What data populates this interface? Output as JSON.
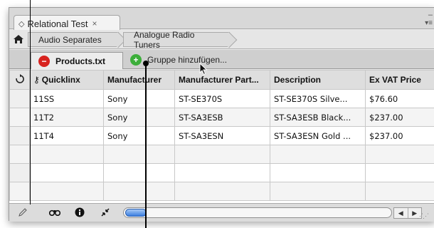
{
  "panel": {
    "tab_title": "Relational Test",
    "tab_icon": "◇",
    "tab_close": "×",
    "minimize": "–",
    "menu": "▾≡",
    "close_icon": "×"
  },
  "breadcrumbs": {
    "home_icon": "home-icon",
    "items": [
      "Audio Separates",
      "Analogue Radio Tuners"
    ]
  },
  "tabs": {
    "active_label": "Products.txt",
    "active_icon": "−",
    "add_icon": "+",
    "add_label": "Gruppe hinzufügen..."
  },
  "table": {
    "columns": [
      "Quicklinx",
      "Manufacturer",
      "Manufacturer Part...",
      "Description",
      "Ex VAT Price"
    ],
    "rows": [
      [
        "11SS",
        "Sony",
        "ST-SE370S",
        "ST-SE370S Silve...",
        "$76.60"
      ],
      [
        "11T2",
        "Sony",
        "ST-SA3ESB",
        "ST-SA3ESB Black...",
        "$237.00"
      ],
      [
        "11T4",
        "Sony",
        "ST-SA3ESN",
        "ST-SA3ESN Gold ...",
        "$237.00"
      ],
      [
        "",
        "",
        "",
        "",
        ""
      ],
      [
        "",
        "",
        "",
        "",
        ""
      ],
      [
        "",
        "",
        "",
        "",
        ""
      ]
    ]
  },
  "bottom_bar": {
    "icons": [
      "pencil-icon",
      "binoculars-icon",
      "info-icon",
      "collapse-icon"
    ],
    "scroll_left": "◀",
    "scroll_right": "▶"
  },
  "colors": {
    "remove": "#d8231f",
    "add": "#3cae3a",
    "scroll_thumb": "#3b7fe0"
  }
}
